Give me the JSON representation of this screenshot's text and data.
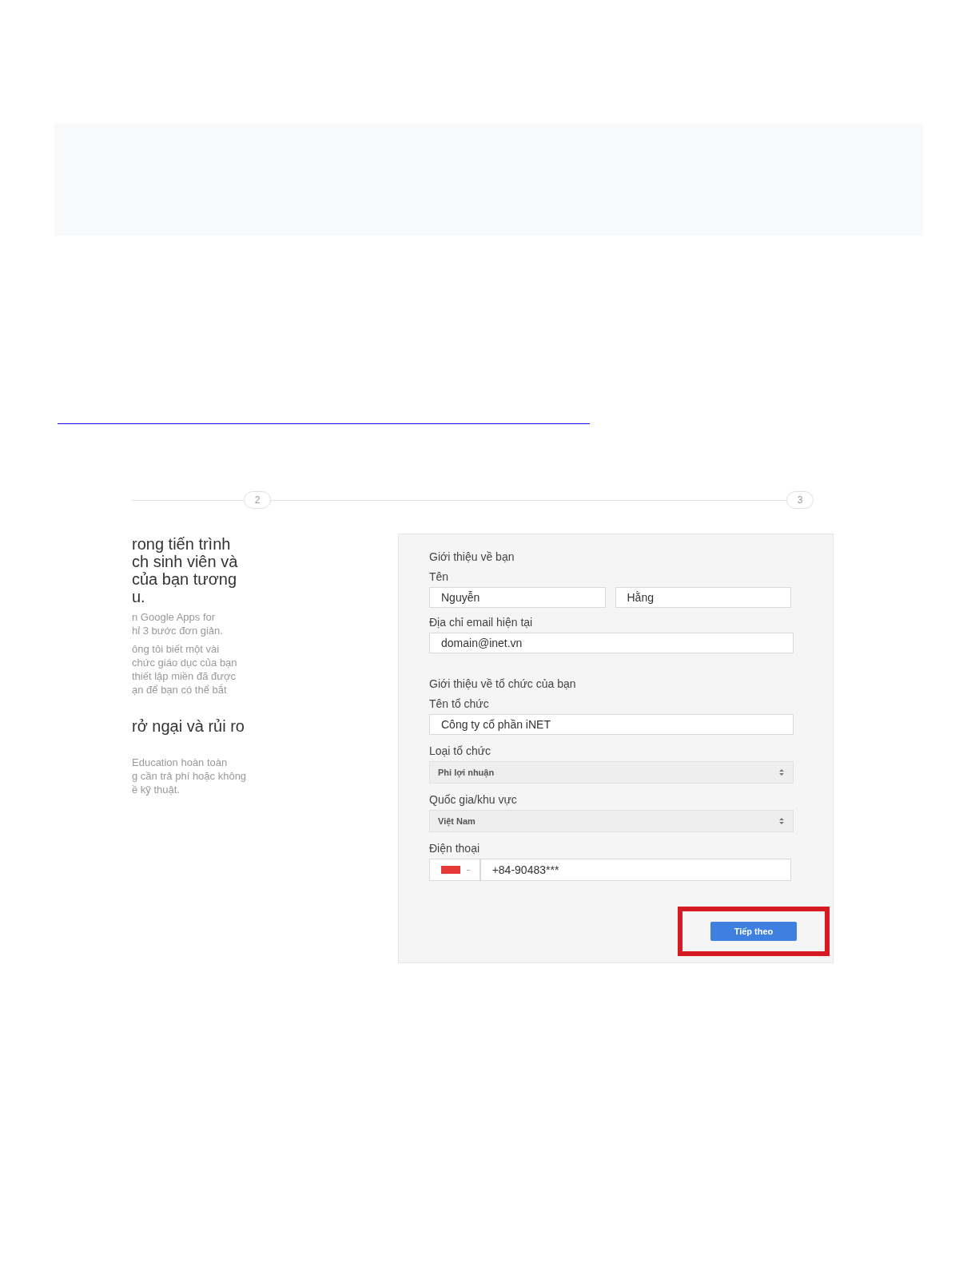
{
  "steps": [
    "2",
    "3"
  ],
  "intro": {
    "heading_lines": [
      "rong tiến trình",
      "ch sinh viên và",
      "của bạn tương",
      "u."
    ],
    "paragraphs": [
      [
        "n Google Apps for",
        "hỉ 3 bước đơn giản."
      ],
      [
        "ông tôi biết một vài",
        "chức giáo dục của bạn",
        "thiết lập miền đã được",
        "ạn để bạn có thể bắt"
      ]
    ],
    "subheading": "rở ngại và rủi ro",
    "closing": [
      "Education hoàn toàn",
      "g cần trả phí hoặc không",
      "ề kỹ thuật."
    ]
  },
  "form": {
    "about_you": "Giới thiệu về bạn",
    "name_label": "Tên",
    "first_name": "Nguyễn",
    "last_name": "Hằng",
    "email_label": "Địa chỉ email hiện tại",
    "email": "domain@inet.vn",
    "about_org": "Giới thiệu về tổ chức của bạn",
    "org_name_label": "Tên tổ chức",
    "org_name": "Công ty cổ phần iNET",
    "org_type_label": "Loại tổ chức",
    "org_type": "Phi lợi nhuận",
    "country_label": "Quốc gia/khu vực",
    "country": "Việt Nam",
    "phone_label": "Điện thoại",
    "phone": "+84-90483***",
    "next_button": "Tiếp theo"
  }
}
